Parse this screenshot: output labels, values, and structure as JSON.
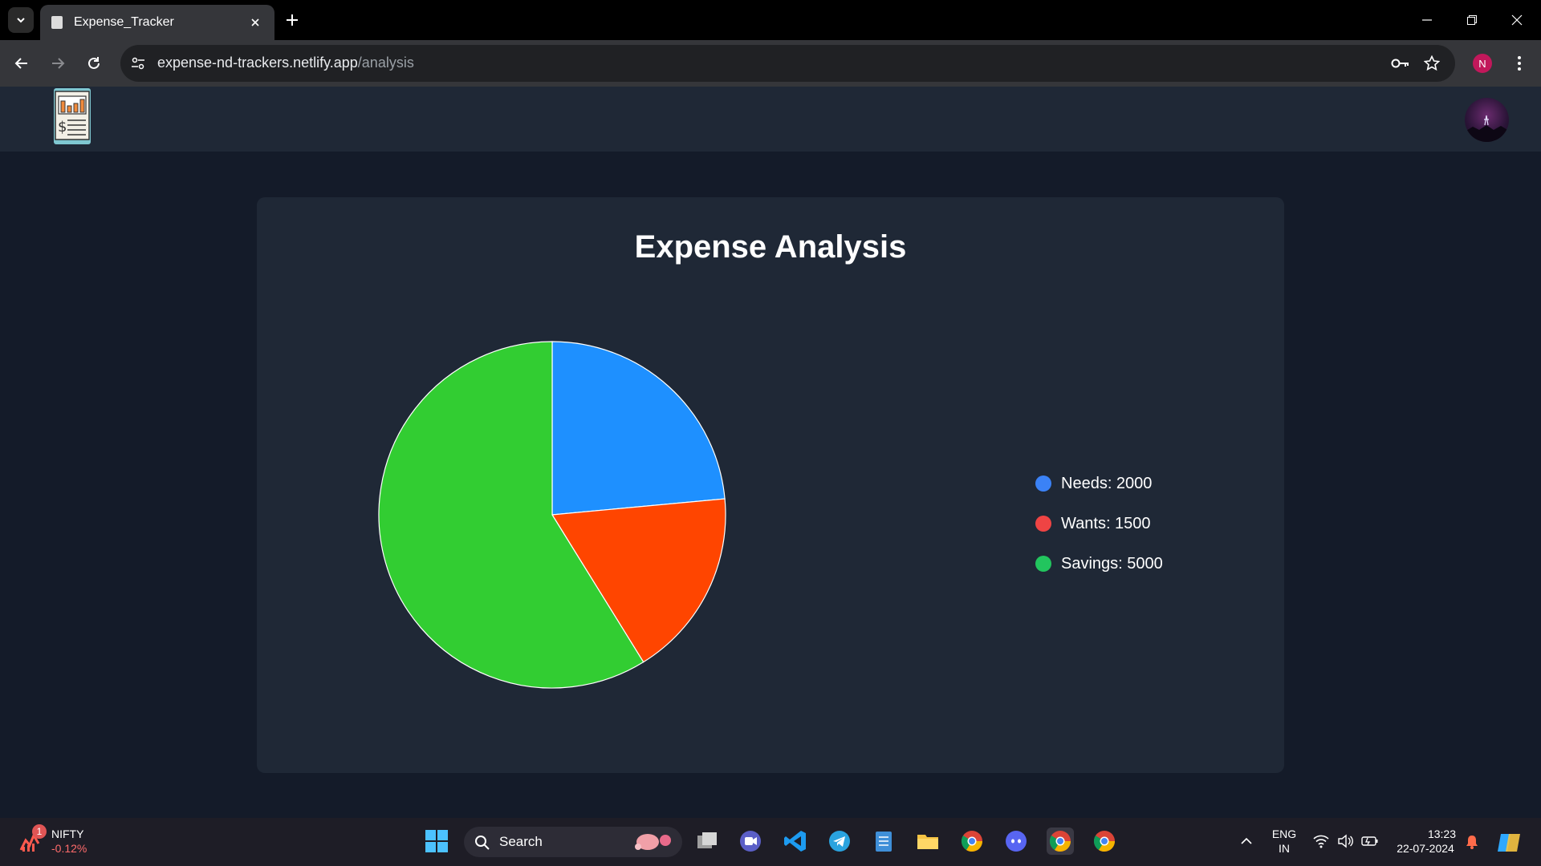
{
  "browser": {
    "tab_title": "Expense_Tracker",
    "url_host": "expense-nd-trackers.netlify.app",
    "url_path": "/analysis",
    "profile_initial": "N"
  },
  "page": {
    "title": "Expense Analysis"
  },
  "legend": [
    {
      "label": "Needs: 2000",
      "color": "#3b82f6"
    },
    {
      "label": "Wants: 1500",
      "color": "#ef4444"
    },
    {
      "label": "Savings: 5000",
      "color": "#22c55e"
    }
  ],
  "chart_data": {
    "type": "pie",
    "categories": [
      "Needs",
      "Wants",
      "Savings"
    ],
    "values": [
      2000,
      1500,
      5000
    ],
    "colors": [
      "#1e90ff",
      "#ff4500",
      "#32cd32"
    ],
    "title": "Expense Analysis",
    "legend_position": "right"
  },
  "taskbar": {
    "widget_name": "NIFTY",
    "widget_change": "-0.12%",
    "widget_badge": "1",
    "search_label": "Search",
    "lang_top": "ENG",
    "lang_bottom": "IN",
    "time": "13:23",
    "date": "22-07-2024"
  }
}
